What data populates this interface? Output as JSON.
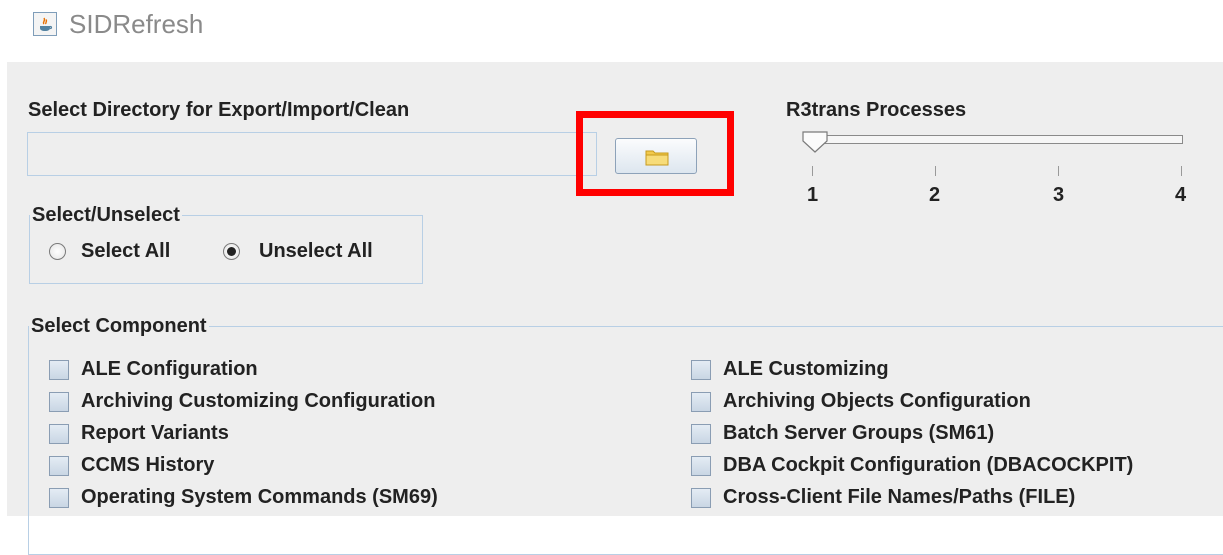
{
  "window": {
    "title": "SIDRefresh",
    "icon": "java-app-icon"
  },
  "directory": {
    "label": "Select Directory for Export/Import/Clean",
    "value": "",
    "browse_icon": "folder-icon"
  },
  "slider": {
    "label": "R3trans Processes",
    "min": 1,
    "max": 4,
    "value": 1,
    "ticks": [
      "1",
      "2",
      "3",
      "4"
    ]
  },
  "select_group": {
    "title": "Select/Unselect",
    "options": [
      "Select All",
      "Unselect All"
    ],
    "selected": "Unselect All"
  },
  "components": {
    "title": "Select Component",
    "left": [
      "ALE Configuration",
      "Archiving Customizing Configuration",
      "Report Variants",
      "CCMS History",
      "Operating System Commands (SM69)"
    ],
    "right": [
      "ALE Customizing",
      "Archiving Objects Configuration",
      "Batch Server Groups (SM61)",
      "DBA Cockpit Configuration (DBACOCKPIT)",
      "Cross-Client File Names/Paths (FILE)"
    ]
  },
  "colors": {
    "highlight": "#ff0000",
    "panel": "#eeeeee",
    "border": "#b8cfe5"
  }
}
